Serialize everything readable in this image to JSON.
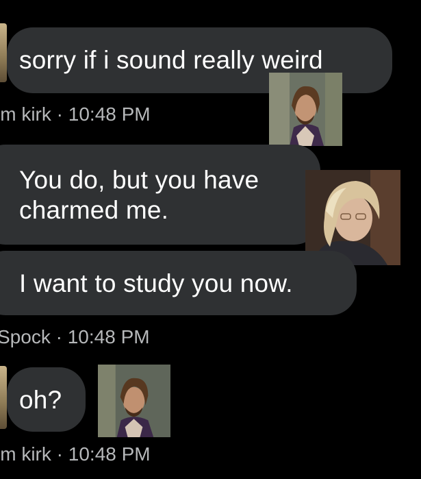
{
  "thread": {
    "messages": [
      {
        "text": "sorry if i sound really weird"
      },
      {
        "text": "You do, but you have charmed me."
      },
      {
        "text": "I want to study you now."
      },
      {
        "text": "oh?"
      }
    ],
    "meta": [
      {
        "sender": "im kirk",
        "separator": "·",
        "time": "10:48 PM"
      },
      {
        "sender": "Spock",
        "separator": "·",
        "time": "10:48 PM"
      },
      {
        "sender": "im kirk",
        "separator": "·",
        "time": "10:48 PM"
      }
    ]
  },
  "icons": {
    "portrait_1": "man-portrait-icon",
    "portrait_2": "woman-portrait-icon",
    "portrait_3": "man-portrait-icon"
  },
  "colors": {
    "background": "#000000",
    "bubble": "#2f3133",
    "meta_text": "#b6b8ba"
  }
}
